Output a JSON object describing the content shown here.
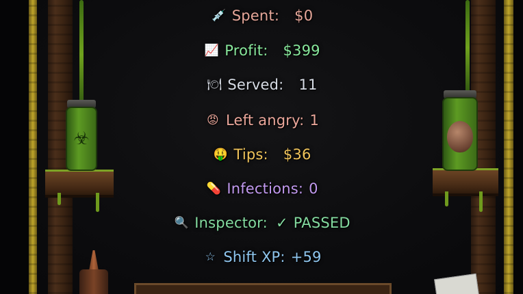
{
  "stats": [
    {
      "key": "spent",
      "icon": "syringe-icon",
      "glyph": "💉",
      "label": "Spent:",
      "value": "$0",
      "color": "#e6a79a"
    },
    {
      "key": "profit",
      "icon": "chart-up-icon",
      "glyph": "📈",
      "label": "Profit:",
      "value": "$399",
      "color": "#88e89c"
    },
    {
      "key": "served",
      "icon": "plate-icon",
      "glyph": "🍽",
      "label": "Served:",
      "value": "11",
      "color": "#d8dde6"
    },
    {
      "key": "angry",
      "icon": "angry-face-icon",
      "glyph": "😡",
      "label": "Left angry:",
      "value": "1",
      "color": "#eba79b"
    },
    {
      "key": "tips",
      "icon": "money-face-icon",
      "glyph": "🤑",
      "label": "Tips:",
      "value": "$36",
      "color": "#f1c45b"
    },
    {
      "key": "infections",
      "icon": "pill-icon",
      "glyph": "💊",
      "label": "Infections:",
      "value": "0",
      "color": "#c29af0"
    },
    {
      "key": "inspector",
      "icon": "magnifier-icon",
      "glyph": "🔍",
      "label": "Inspector:",
      "check": "✓",
      "value": "PASSED",
      "color": "#84dba0"
    },
    {
      "key": "xp",
      "icon": "star-icon",
      "glyph": "☆",
      "label": "Shift XP:",
      "value": "+59",
      "color": "#8fc6ef"
    }
  ]
}
